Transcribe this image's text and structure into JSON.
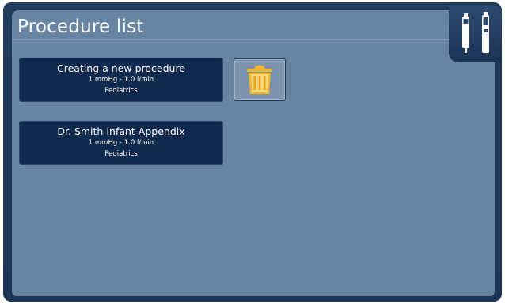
{
  "header": {
    "title": "Procedure list"
  },
  "toolbar": {
    "tools_icon": "instrument-tubes-icon"
  },
  "procedures": [
    {
      "name": "Creating a new procedure",
      "settings": "1 mmHg - 1.0 l/min",
      "category": "Pediatrics"
    },
    {
      "name": "Dr. Smith Infant Appendix",
      "settings": "1 mmHg - 1.0 l/min",
      "category": "Pediatrics"
    }
  ],
  "actions": {
    "delete_icon": "trash-icon"
  },
  "colors": {
    "frame": "#1c3456",
    "panel": "#6784a2",
    "item": "#0f2a4d",
    "trash_accent": "#f0b82a"
  }
}
